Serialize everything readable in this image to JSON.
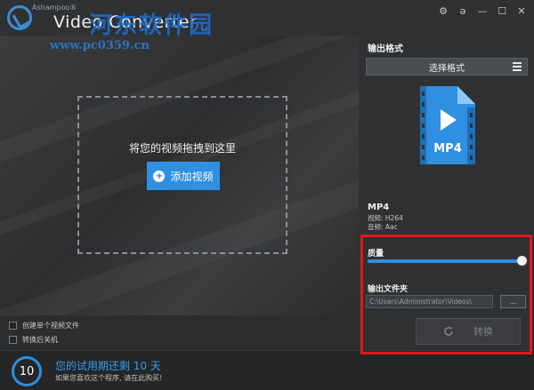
{
  "titlebar": {
    "brand_small": "Ashampoo®",
    "app_title": "Video Converter",
    "watermark_cn": "河东软件园",
    "watermark_url": "www.pc0359.cn",
    "controls": {
      "settings": "⚙",
      "help": "ə",
      "minimize": "—",
      "maximize": "☐",
      "close": "✕"
    }
  },
  "main": {
    "drop_text": "将您的视频拖拽到这里",
    "add_video_label": "添加视频"
  },
  "options": {
    "single_file_label": "创建单个视频文件",
    "shutdown_label": "转换后关机"
  },
  "trial": {
    "days": "10",
    "main_text": "您的试用期还剩 10 天",
    "sub_text": "如果您喜欢这个程序, 请在此购买!"
  },
  "right_panel": {
    "output_format_label": "输出格式",
    "select_format_label": "选择格式",
    "file_icon_text": "MP4",
    "format_name": "MP4",
    "video_codec": "视频: H264",
    "audio_codec": "音频: Aac",
    "quality_label": "质量",
    "quality_value": 1.0,
    "output_folder_label": "输出文件夹",
    "output_folder_value": "C:\\Users\\Administrator\\Videos\\",
    "browse_label": "...",
    "convert_label": "转换"
  },
  "colors": {
    "accent": "#2f8fe0",
    "highlight_box": "#e3161b",
    "panel_bg": "#2f3133"
  }
}
